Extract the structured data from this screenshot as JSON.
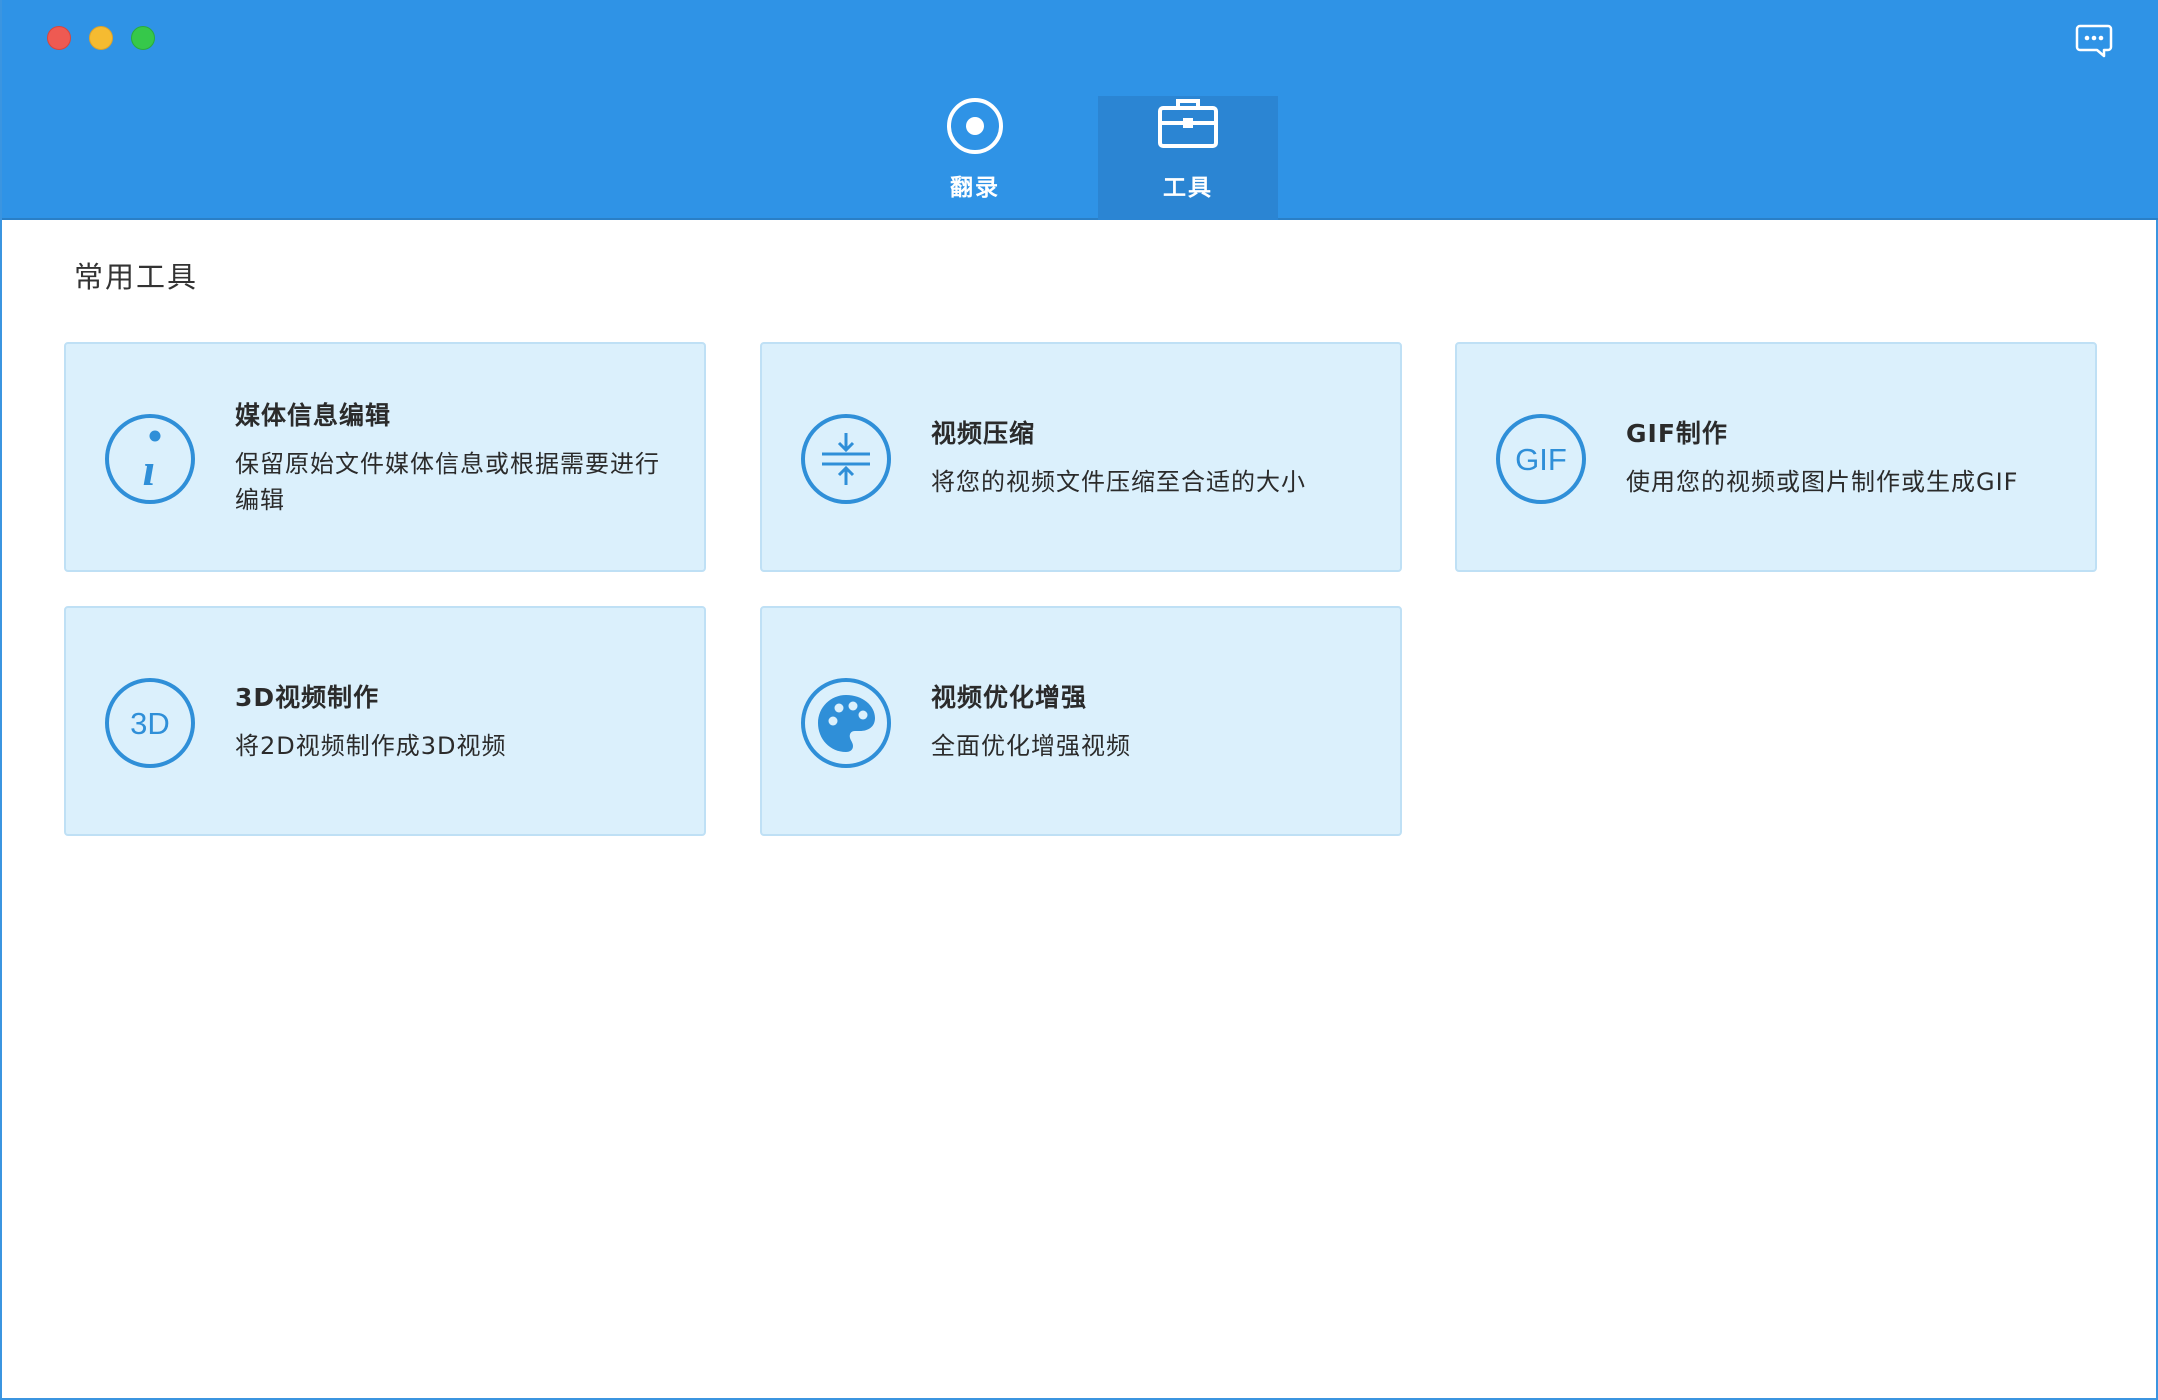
{
  "header": {
    "tabs": [
      {
        "label": "翻录",
        "icon": "record-icon",
        "active": false
      },
      {
        "label": "工具",
        "icon": "toolbox-icon",
        "active": true
      }
    ],
    "feedback_icon": "chat-bubble-icon"
  },
  "main": {
    "section_title": "常用工具",
    "cards": [
      {
        "title": "媒体信息编辑",
        "desc": "保留原始文件媒体信息或根据需要进行编辑",
        "icon": "info-icon"
      },
      {
        "title": "视频压缩",
        "desc": "将您的视频文件压缩至合适的大小",
        "icon": "compress-icon"
      },
      {
        "title": "GIF制作",
        "desc": "使用您的视频或图片制作或生成GIF",
        "icon": "gif-icon",
        "icon_text": "GIF"
      },
      {
        "title": "3D视频制作",
        "desc": "将2D视频制作成3D视频",
        "icon": "3d-icon",
        "icon_text": "3D"
      },
      {
        "title": "视频优化增强",
        "desc": "全面优化增强视频",
        "icon": "palette-icon"
      }
    ]
  },
  "colors": {
    "header_bg": "#2f93e6",
    "active_tab_bg": "#2b85d3",
    "card_bg": "#dbf0fc",
    "card_border": "#bfe0f5",
    "icon_blue": "#2f8fd8"
  }
}
